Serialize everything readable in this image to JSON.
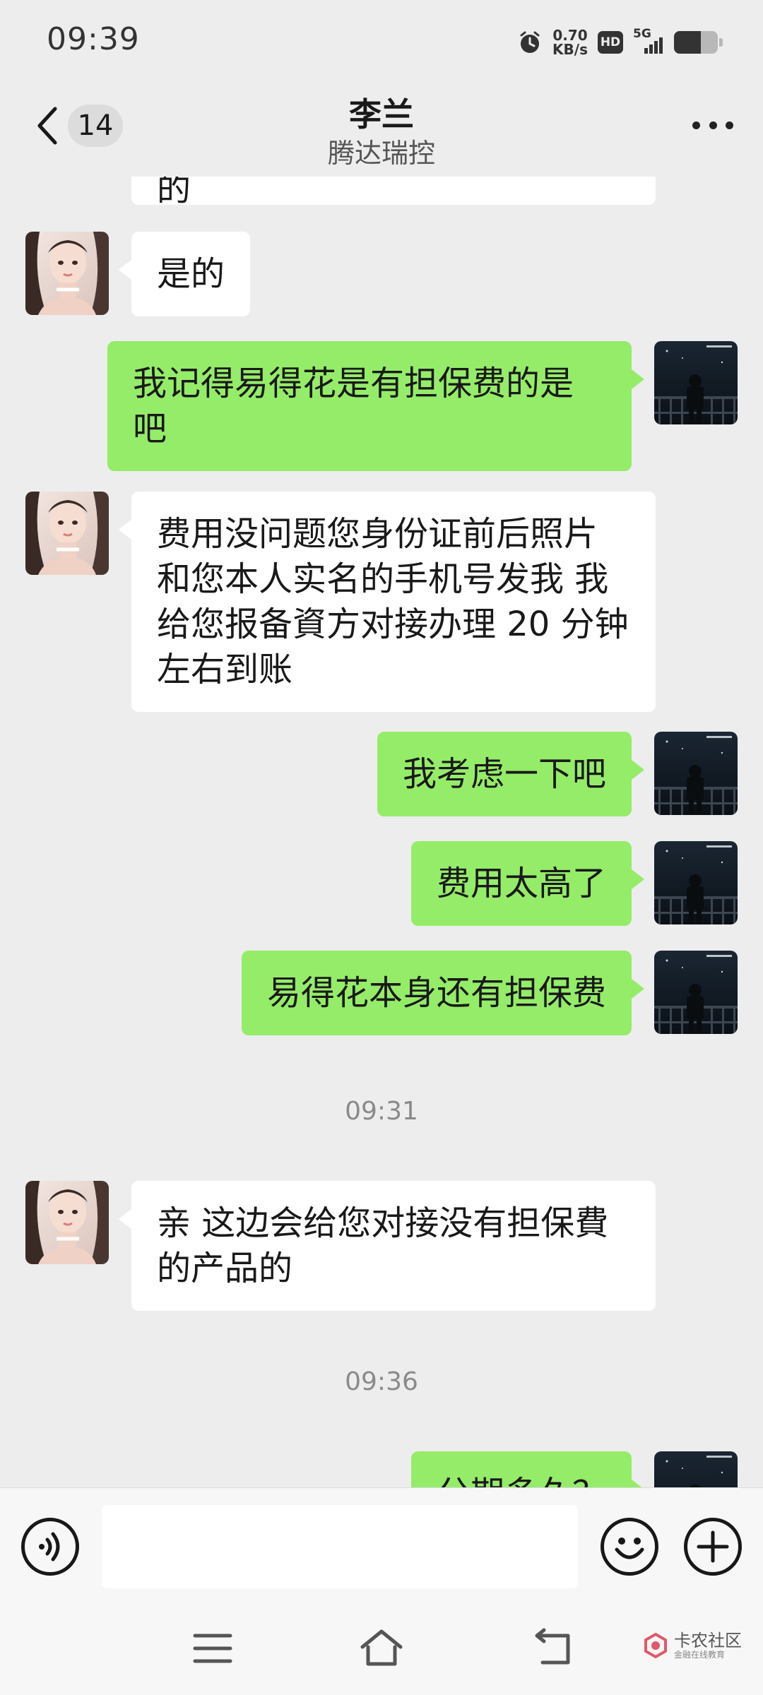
{
  "status_bar": {
    "time": "09:39",
    "net_speed_value": "0.70",
    "net_speed_unit": "KB/s",
    "hd_label": "HD",
    "network_label": "5G",
    "battery_level": 0.62,
    "icons": [
      "alarm-icon",
      "hd-icon",
      "signal-icon",
      "battery-icon"
    ]
  },
  "header": {
    "back_icon": "chevron-left-icon",
    "unread_count": "14",
    "title": "李兰",
    "subtitle": "腾达瑞控",
    "more_icon": "more-dots-icon"
  },
  "messages": [
    {
      "side": "in",
      "text": "的"
    },
    {
      "side": "in",
      "text": "是的"
    },
    {
      "side": "out",
      "text": "我记得易得花是有担保费的是吧"
    },
    {
      "side": "in",
      "text": "费用没问题您身份证前后照片和您本人实名的手机号发我 我给您报备資方对接办理 20 分钟左右到账"
    },
    {
      "side": "out",
      "text": "我考虑一下吧"
    },
    {
      "side": "out",
      "text": "费用太高了"
    },
    {
      "side": "out",
      "text": "易得花本身还有担保费"
    },
    {
      "type": "time",
      "text": "09:31"
    },
    {
      "side": "in",
      "text": "亲 这边会给您对接没有担保費的产品的"
    },
    {
      "type": "time",
      "text": "09:36"
    },
    {
      "side": "out",
      "text": "分期多久？"
    }
  ],
  "input_bar": {
    "voice_icon": "voice-icon",
    "text_value": "",
    "emoji_icon": "emoji-icon",
    "plus_icon": "plus-icon"
  },
  "nav_bar": {
    "menu_icon": "menu-icon",
    "home_icon": "home-icon",
    "back_icon": "back-icon",
    "watermark_title": "卡农社区",
    "watermark_sub": "金融在线教育"
  },
  "colors": {
    "background": "#ededed",
    "outgoing_bubble": "#95ec69",
    "incoming_bubble": "#ffffff"
  }
}
